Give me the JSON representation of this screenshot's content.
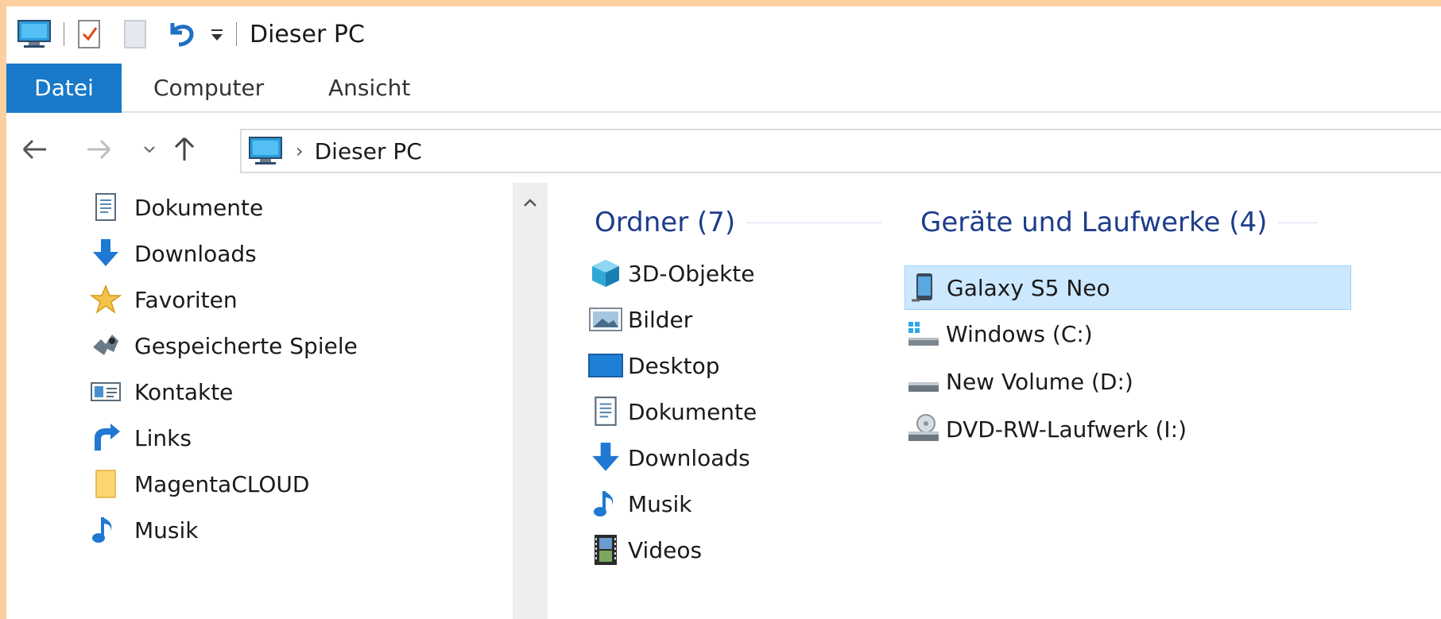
{
  "window": {
    "title": "Dieser PC"
  },
  "ribbon": {
    "tabs": [
      "Datei",
      "Computer",
      "Ansicht"
    ]
  },
  "address": {
    "path": "Dieser PC"
  },
  "nav_pane": {
    "items": [
      {
        "label": "Dokumente",
        "icon": "document-icon"
      },
      {
        "label": "Downloads",
        "icon": "download-icon"
      },
      {
        "label": "Favoriten",
        "icon": "star-icon"
      },
      {
        "label": "Gespeicherte Spiele",
        "icon": "game-icon"
      },
      {
        "label": "Kontakte",
        "icon": "contact-icon"
      },
      {
        "label": "Links",
        "icon": "link-arrow-icon"
      },
      {
        "label": "MagentaCLOUD",
        "icon": "folder-icon"
      },
      {
        "label": "Musik",
        "icon": "music-icon"
      }
    ]
  },
  "content": {
    "folders": {
      "title": "Ordner (7)",
      "items": [
        {
          "label": "3D-Objekte",
          "icon": "3d-objects-icon"
        },
        {
          "label": "Bilder",
          "icon": "pictures-icon"
        },
        {
          "label": "Desktop",
          "icon": "desktop-icon"
        },
        {
          "label": "Dokumente",
          "icon": "document-icon"
        },
        {
          "label": "Downloads",
          "icon": "download-icon"
        },
        {
          "label": "Musik",
          "icon": "music-icon"
        },
        {
          "label": "Videos",
          "icon": "video-icon"
        }
      ]
    },
    "devices": {
      "title": "Geräte und Laufwerke (4)",
      "items": [
        {
          "label": "Galaxy S5 Neo",
          "icon": "phone-icon",
          "selected": true
        },
        {
          "label": "Windows (C:)",
          "icon": "windows-drive-icon"
        },
        {
          "label": "New Volume (D:)",
          "icon": "drive-icon"
        },
        {
          "label": "DVD-RW-Laufwerk (I:)",
          "icon": "dvd-drive-icon"
        }
      ]
    }
  },
  "colors": {
    "accent": "#1979ca",
    "header": "#1e3c8c",
    "selection": "#cce8ff",
    "frame": "#fbcf9f"
  }
}
